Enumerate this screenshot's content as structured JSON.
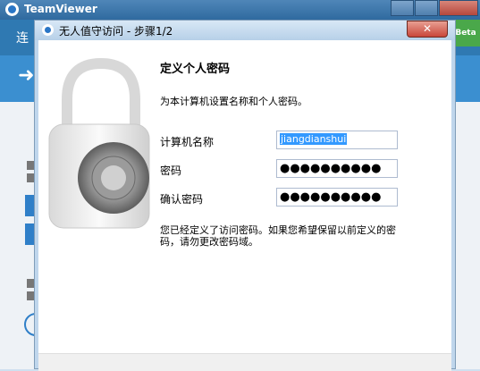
{
  "app": {
    "title": "TeamViewer",
    "tab_label": "连",
    "beta": "Beta"
  },
  "dialog": {
    "title": "无人值守访问 - 步骤1/2",
    "close": "✕",
    "heading": "定义个人密码",
    "description": "为本计算机设置名称和个人密码。",
    "fields": {
      "computer_name": {
        "label": "计算机名称",
        "value": "jiangdianshui"
      },
      "password": {
        "label": "密码",
        "value": "●●●●●●●●●●"
      },
      "confirm_password": {
        "label": "确认密码",
        "value": "●●●●●●●●●●"
      }
    },
    "note": "您已经定义了访问密码。如果您希望保留以前定义的密码，请勿更改密码域。"
  }
}
